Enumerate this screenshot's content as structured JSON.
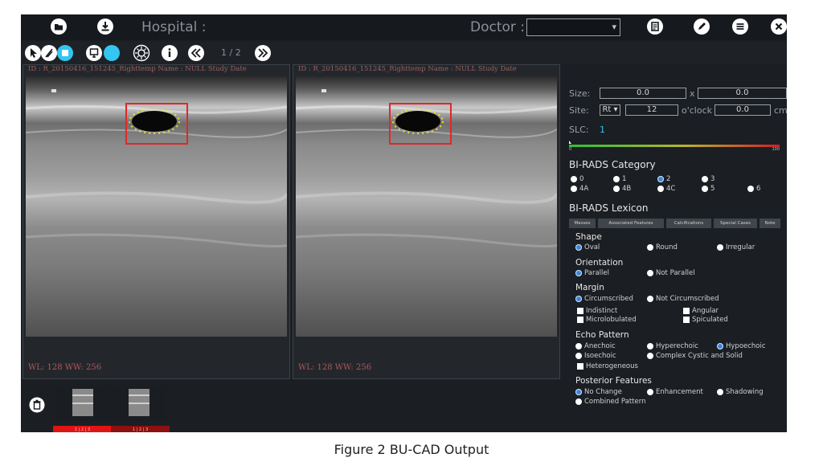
{
  "header": {
    "hospital_label": "Hospital :",
    "doctor_label": "Doctor :",
    "doctor_value": ""
  },
  "toolbar": {
    "page_indicator": "1 / 2"
  },
  "panels": [
    {
      "id_text": "ID : R_20150416_151245_Righttemp Name : NULL Study Date",
      "wl_text": "WL: 128 WW: 256"
    },
    {
      "id_text": "ID : R_20150416_151245_Righttemp Name : NULL Study Date",
      "wl_text": "WL: 128 WW: 256"
    }
  ],
  "thumbnails": [
    {
      "label": "1 | 2 | 3"
    },
    {
      "label": "1 | 2 | 3"
    }
  ],
  "info": {
    "size_label": "Size:",
    "size_w": "0.0",
    "size_x": "x",
    "size_h": "0.0",
    "site_label": "Site:",
    "site_side": "Rt",
    "site_clock": "12",
    "clock_label": "o'clock",
    "site_dist": "0.0",
    "site_unit": "cm",
    "slc_label": "SLC:",
    "slc_value": "1",
    "scale_min": "0",
    "scale_max": "100"
  },
  "birads_category": {
    "title": "BI-RADS Category",
    "options": [
      "0",
      "1",
      "2",
      "3",
      "4A",
      "4B",
      "4C",
      "5",
      "6"
    ],
    "selected": "2"
  },
  "birads_lexicon": {
    "title": "BI-RADS Lexicon",
    "tabs": [
      "Masses",
      "Associated Features",
      "Calcifications",
      "Special Cases",
      "Note"
    ],
    "shape": {
      "title": "Shape",
      "options": [
        "Oval",
        "Round",
        "Irregular"
      ],
      "selected": "Oval"
    },
    "orientation": {
      "title": "Orientation",
      "options": [
        "Parallel",
        "Not Parallel"
      ],
      "selected": "Parallel"
    },
    "margin": {
      "title": "Margin",
      "options": [
        "Circumscribed",
        "Not Circumscribed"
      ],
      "selected": "Circumscribed",
      "checks": [
        "Indistinct",
        "Angular",
        "Microlobulated",
        "Spiculated"
      ]
    },
    "echo": {
      "title": "Echo Pattern",
      "options": [
        "Anechoic",
        "Hyperechoic",
        "Hypoechoic",
        "Isoechoic",
        "Complex Cystic and Solid"
      ],
      "selected": "Hypoechoic",
      "checks": [
        "Heterogeneous"
      ]
    },
    "posterior": {
      "title": "Posterior Features",
      "options": [
        "No Change",
        "Enhancement",
        "Shadowing",
        "Combined Pattern"
      ],
      "selected": "No Change"
    }
  },
  "caption": "Figure 2 BU-CAD Output"
}
